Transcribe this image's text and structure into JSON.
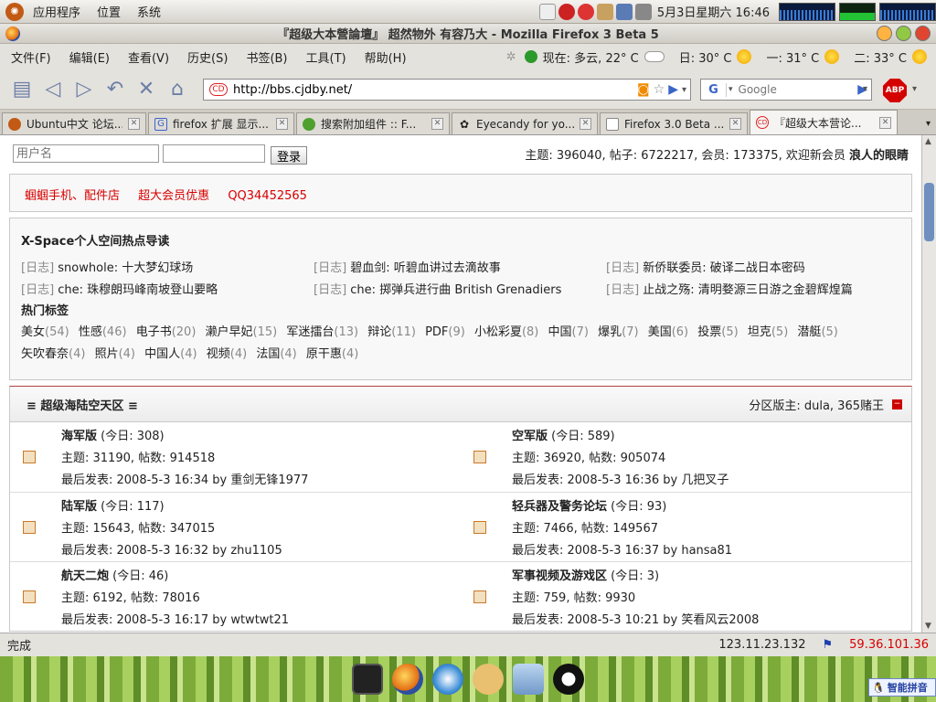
{
  "top_panel": {
    "menus": [
      "应用程序",
      "位置",
      "系统"
    ],
    "clock": "5月3日星期六 16:46"
  },
  "window": {
    "title": "『超级大本營論壇』 超然物外 有容乃大 - Mozilla Firefox 3 Beta 5"
  },
  "menubar": {
    "items": [
      "文件(F)",
      "编辑(E)",
      "查看(V)",
      "历史(S)",
      "书签(B)",
      "工具(T)",
      "帮助(H)"
    ],
    "weather_now": "现在: 多云, 22° C",
    "weather_sun": "日: 30° C",
    "weather_mon": "一: 31° C",
    "weather_tue": "二: 33° C"
  },
  "navbar": {
    "url": "http://bbs.cjdby.net/",
    "search_placeholder": "Google",
    "abp_label": "ABP"
  },
  "tabs": [
    {
      "label": "Ubuntu中文 论坛..."
    },
    {
      "label": "firefox 扩展 显示..."
    },
    {
      "label": "搜索附加组件 :: F..."
    },
    {
      "label": "Eyecandy for yo..."
    },
    {
      "label": "Firefox 3.0 Beta ..."
    },
    {
      "label": "『超级大本营论..."
    }
  ],
  "login": {
    "username_placeholder": "用户名",
    "login_button": "登录",
    "stats_prefix": "主题: 396040, 帖子: 6722217, 会员: 173375, 欢迎新会员 ",
    "new_member": "浪人的眼睛"
  },
  "ads": [
    "蝈蝈手机、配件店",
    "超大会员优惠",
    "QQ34452565"
  ],
  "xspace": {
    "title": "X-Space个人空间热点导读",
    "rows": [
      [
        {
          "tag": "[日志]",
          "text": " snowhole: 十大梦幻球场"
        },
        {
          "tag": "[日志]",
          "text": " 碧血剑: 听碧血讲过去滴故事"
        },
        {
          "tag": "[日志]",
          "text": " 新侨联委员: 破译二战日本密码"
        }
      ],
      [
        {
          "tag": "[日志]",
          "text": " che: 珠穆朗玛峰南坡登山要略"
        },
        {
          "tag": "[日志]",
          "text": " che: 掷弹兵进行曲 British Grenadiers"
        },
        {
          "tag": "[日志]",
          "text": " 止战之殇: 清明婺源三日游之金碧辉煌篇"
        }
      ]
    ],
    "hot_tags_title": "热门标签",
    "hot_tags": [
      {
        "name": "美女",
        "count": "(54)"
      },
      {
        "name": "性感",
        "count": "(46)"
      },
      {
        "name": "电子书",
        "count": "(20)"
      },
      {
        "name": "濑户早妃",
        "count": "(15)"
      },
      {
        "name": "军迷擂台",
        "count": "(13)"
      },
      {
        "name": "辩论",
        "count": "(11)"
      },
      {
        "name": "PDF",
        "count": "(9)"
      },
      {
        "name": "小松彩夏",
        "count": "(8)"
      },
      {
        "name": "中国",
        "count": "(7)"
      },
      {
        "name": "爆乳",
        "count": "(7)"
      },
      {
        "name": "美国",
        "count": "(6)"
      },
      {
        "name": "投票",
        "count": "(5)"
      },
      {
        "name": "坦克",
        "count": "(5)"
      },
      {
        "name": "潜艇",
        "count": "(5)"
      },
      {
        "name": "矢吹春奈",
        "count": "(4)"
      },
      {
        "name": "照片",
        "count": "(4)"
      },
      {
        "name": "中国人",
        "count": "(4)"
      },
      {
        "name": "视频",
        "count": "(4)"
      },
      {
        "name": "法国",
        "count": "(4)"
      },
      {
        "name": "原干惠",
        "count": "(4)"
      }
    ]
  },
  "forum_section": {
    "title": "≡ 超级海陆空天区 ≡",
    "moderators": "分区版主: dula, 365赌王",
    "rows": [
      [
        {
          "name": "海军版",
          "today": " (今日: 308)",
          "stats": "主题: 31190, 帖数: 914518",
          "last": "最后发表: 2008-5-3 16:34 by 重剑无锋1977"
        },
        {
          "name": "空军版",
          "today": " (今日: 589)",
          "stats": "主题: 36920, 帖数: 905074",
          "last": "最后发表: 2008-5-3 16:36 by 几把叉子"
        }
      ],
      [
        {
          "name": "陆军版",
          "today": " (今日: 117)",
          "stats": "主题: 15643, 帖数: 347015",
          "last": "最后发表: 2008-5-3 16:32 by zhu1105"
        },
        {
          "name": "轻兵器及警务论坛",
          "today": " (今日: 93)",
          "stats": "主题: 7466, 帖数: 149567",
          "last": "最后发表: 2008-5-3 16:37 by hansa81"
        }
      ],
      [
        {
          "name": "航天二炮",
          "today": " (今日: 46)",
          "stats": "主题: 6192, 帖数: 78016",
          "last": "最后发表: 2008-5-3 16:17 by wtwtwt21"
        },
        {
          "name": "军事视频及游戏区",
          "today": " (今日: 3)",
          "stats": "主题: 759, 帖数: 9930",
          "last": "最后发表: 2008-5-3 10:21 by 笑看风云2008"
        }
      ]
    ]
  },
  "statusbar": {
    "status": "完成",
    "ip_local": "123.11.23.132",
    "ip_remote": "59.36.101.36"
  },
  "ime": {
    "label": "智能拼音"
  },
  "colors": {
    "accent_red": "#d80000",
    "link_blue": "#3a64c8"
  }
}
